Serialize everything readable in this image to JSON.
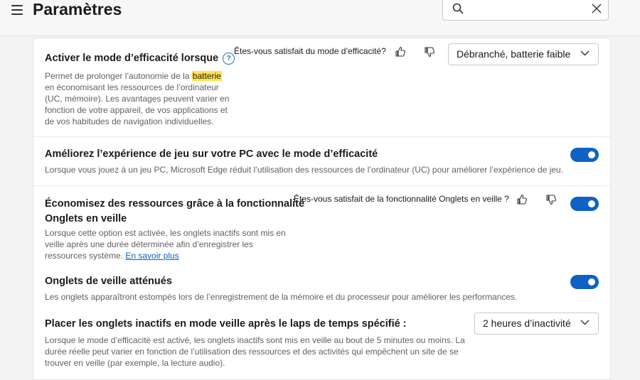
{
  "header": {
    "title": "Paramètres",
    "search": {
      "value": "",
      "placeholder": ""
    }
  },
  "efficiency": {
    "title": "Activer le mode d’efficacité lorsque",
    "help": "?",
    "desc_1": "Permet de prolonger l’autonomie de la ",
    "desc_highlight": "batterie",
    "desc_2": "en économisant les ressources de l’ordinateur",
    "desc_3": "(UC, mémoire). Les avantages peuvent varier en",
    "desc_4": "fonction de votre appareil, de vos applications et",
    "desc_5": "de vos habitudes de navigation individuelles.",
    "feedback": "Êtes-vous satisfait du mode d’efficacité?",
    "dropdown_value": "Débranché, batterie faible"
  },
  "gaming": {
    "title": "Améliorez l’expérience de jeu sur votre PC avec le mode d’efficacité",
    "desc": "Lorsque vous jouez à un jeu PC, Microsoft Edge réduit l’utilisation des ressources de l’ordinateur (UC) pour améliorer l’expérience de jeu.",
    "enabled": true
  },
  "sleeping_tabs": {
    "title_1": "Économisez des ressources grâce à la fonctionnalité",
    "title_2": "Onglets en veille",
    "desc_1": "Lorsque cette option est activée, les onglets inactifs sont mis en",
    "desc_2": "veille après une durée déterminée afin d’enregistrer les",
    "desc_3": "ressources système. ",
    "learn_more": "En savoir plus",
    "feedback": "Êtes-vous satisfait de la fonctionnalité Onglets en veille ?",
    "enabled": true
  },
  "faded_tabs": {
    "title": "Onglets de veille atténués",
    "desc": "Les onglets apparaîtront estompés lors de l’enregistrement de la mémoire et du processeur pour améliorer les performances.",
    "enabled": true
  },
  "inactive_timeout": {
    "title": "Placer les onglets inactifs en mode veille après le laps de temps spécifié :",
    "desc_1": "Lorsque le mode d’efficacité est activé, les onglets inactifs sont mis en veille au bout de 5 minutes ou moins. La",
    "desc_2": "durée réelle peut varier en fonction de l’utilisation des ressources et des activités qui empêchent un site de se",
    "desc_3": "trouver en veille (par exemple, la lecture audio).",
    "dropdown_value": "2 heures d’inactivité"
  },
  "colors": {
    "accent": "#0f62c4",
    "highlight": "#ffe34c",
    "link": "#0f5fbf"
  },
  "icons": [
    "menu-icon",
    "search-icon",
    "close-icon",
    "help-icon",
    "thumbs-up-icon",
    "thumbs-down-icon",
    "chevron-down-icon"
  ]
}
